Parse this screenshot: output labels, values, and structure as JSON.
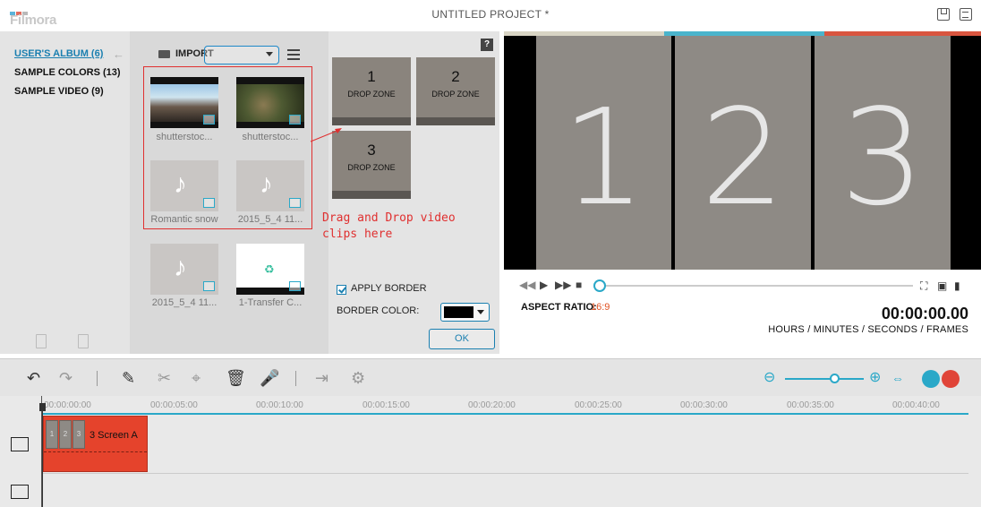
{
  "app": {
    "logo": "Filmora",
    "project_title": "UNTITLED PROJECT *",
    "logo_bar_colors": [
      "#5bb3d9",
      "#e26c5e",
      "#b9b9b9"
    ]
  },
  "albums": {
    "items": [
      {
        "label": "USER'S ALBUM (6)",
        "active": true
      },
      {
        "label": "SAMPLE COLORS (13)",
        "active": false
      },
      {
        "label": "SAMPLE VIDEO (9)",
        "active": false
      }
    ]
  },
  "media": {
    "import_label": "IMPORT",
    "items": [
      {
        "label": "shutterstoc...",
        "kind": "video"
      },
      {
        "label": "shutterstoc...",
        "kind": "video"
      },
      {
        "label": "Romantic snow",
        "kind": "audio"
      },
      {
        "label": "2015_5_4 11...",
        "kind": "audio"
      },
      {
        "label": "2015_5_4 11...",
        "kind": "audio"
      },
      {
        "label": "1-Transfer C...",
        "kind": "transfer"
      }
    ]
  },
  "annotation": {
    "text": "Drag and Drop video\nclips here",
    "color": "#e03030"
  },
  "dropzones": {
    "help": "?",
    "zones": [
      {
        "number": "1",
        "label": "DROP ZONE"
      },
      {
        "number": "2",
        "label": "DROP ZONE"
      },
      {
        "number": "3",
        "label": "DROP ZONE"
      }
    ],
    "apply_border_label": "APPLY BORDER",
    "apply_border_checked": true,
    "border_color_label": "BORDER COLOR:",
    "border_color": "#000000",
    "ok_label": "OK"
  },
  "preview": {
    "panels": [
      "1",
      "2",
      "3"
    ],
    "top_bar_colors": [
      "#d8d4c4",
      "#4ab4cc",
      "#d9553f"
    ],
    "aspect_label": "ASPECT RATIO:",
    "aspect_value": "16:9",
    "timecode": "00:00:00.00",
    "timecode_units": "HOURS / MINUTES / SECONDS / FRAMES",
    "progress": 0
  },
  "toolbar": {
    "accent": "#2aa8c8",
    "zoom_level": 0.55
  },
  "timeline": {
    "ticks": [
      "00:00:00:00",
      "00:00:05:00",
      "00:00:10:00",
      "00:00:15:00",
      "00:00:20:00",
      "00:00:25:00",
      "00:00:30:00",
      "00:00:35:00",
      "00:00:40:00"
    ],
    "clip": {
      "title": "3 Screen A",
      "thumbs": [
        "1",
        "2",
        "3"
      ],
      "color": "#e5432c"
    }
  }
}
